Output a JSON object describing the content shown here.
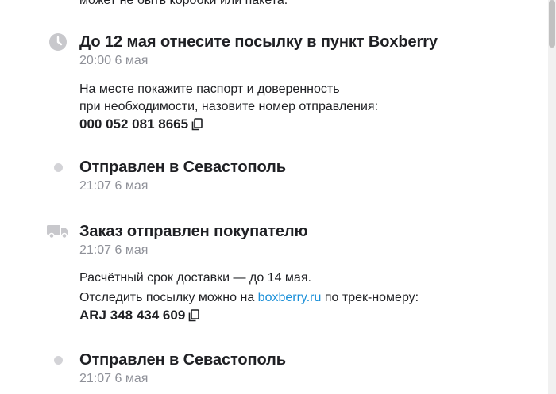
{
  "top_fragment": "может не быть коробки или пакета.",
  "events": [
    {
      "icon": "clock-icon",
      "title": "До 12 мая отнесите посылку в пункт Boxberry",
      "time": "20:00 6 мая",
      "text_line1": "На месте покажите паспорт и доверенность",
      "text_line2": "при необходимости, назовите номер отправления:",
      "track_number": "000 052 081 8665"
    },
    {
      "icon": "dot-icon",
      "title": "Отправлен в Севастополь",
      "time": "21:07 6 мая"
    },
    {
      "icon": "truck-icon",
      "title": "Заказ отправлен покупателю",
      "time": "21:07 6 мая",
      "text_line1": "Расчётный срок доставки — до 14 мая.",
      "text_prefix": "Отследить посылку можно на ",
      "link": "boxberry.ru",
      "text_suffix": " по трек-номеру:",
      "track_number": "ARJ 348 434 609"
    },
    {
      "icon": "dot-icon",
      "title": "Отправлен в Севастополь",
      "time": "21:07 6 мая"
    }
  ],
  "colors": {
    "text": "#1f2024",
    "muted": "#8f9199",
    "icon": "#c8c8cc",
    "link": "#1a8fd8"
  }
}
